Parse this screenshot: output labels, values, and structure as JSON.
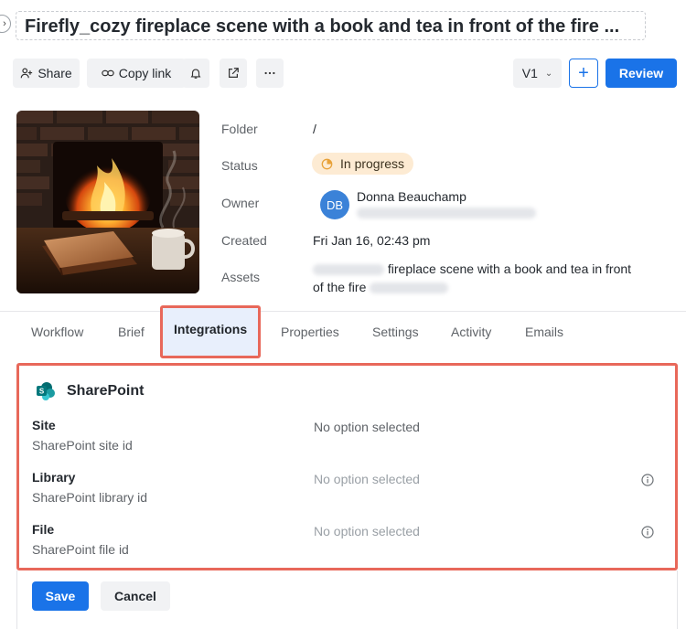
{
  "header": {
    "title": "Firefly_cozy fireplace scene with a book and tea in front of the fire ..."
  },
  "toolbar": {
    "share_label": "Share",
    "copy_link_label": "Copy link",
    "version_label": "V1",
    "review_label": "Review",
    "add_label": "+"
  },
  "details": {
    "folder_label": "Folder",
    "folder_value": "/",
    "status_label": "Status",
    "status_value": "In progress",
    "owner_label": "Owner",
    "owner_initials": "DB",
    "owner_name": "Donna Beauchamp",
    "created_label": "Created",
    "created_value": "Fri Jan 16, 02:43 pm",
    "assets_label": "Assets",
    "assets_text_1": "fireplace scene with a book and tea in front",
    "assets_text_2": "of the fire"
  },
  "tabs": [
    "Workflow",
    "Brief",
    "Integrations",
    "Properties",
    "Settings",
    "Activity",
    "Emails"
  ],
  "integration": {
    "name": "SharePoint",
    "fields": [
      {
        "label": "Site",
        "sub": "SharePoint site id",
        "value": "No option selected"
      },
      {
        "label": "Library",
        "sub": "SharePoint library id",
        "value": "No option selected"
      },
      {
        "label": "File",
        "sub": "SharePoint file id",
        "value": "No option selected"
      }
    ]
  },
  "actions": {
    "save_label": "Save",
    "cancel_label": "Cancel"
  },
  "colors": {
    "accent": "#1a73e8",
    "highlight_border": "#e8685a",
    "status_badge_bg": "#fdebd3"
  }
}
